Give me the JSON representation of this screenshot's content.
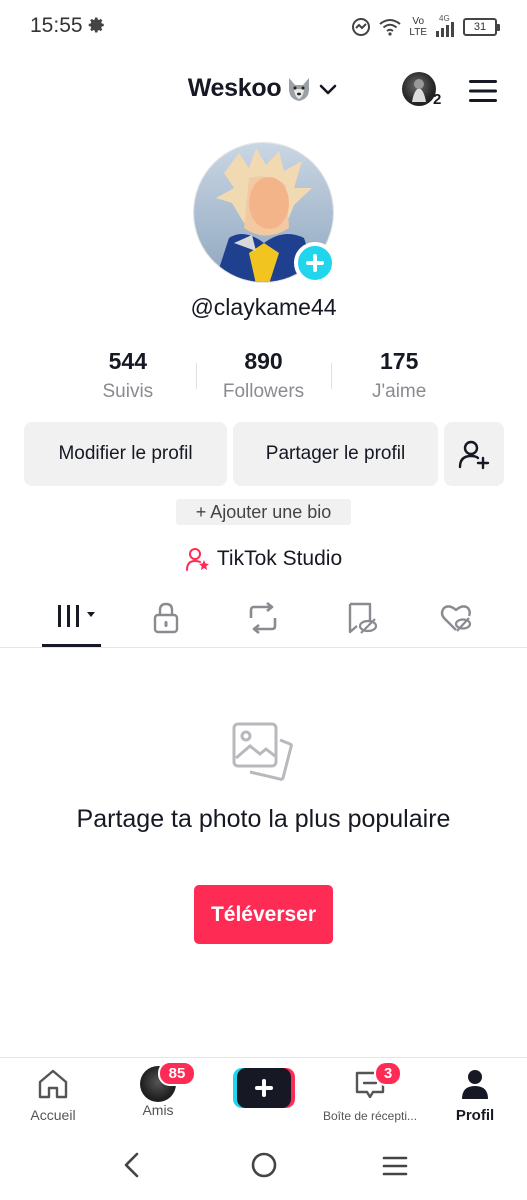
{
  "status": {
    "time": "15:55",
    "volte_top": "Vo",
    "volte_bottom": "LTE",
    "signal_label": "4G",
    "battery": "31"
  },
  "header": {
    "username": "Weskoo",
    "following_count_badge": "2"
  },
  "profile": {
    "handle": "@claykame44"
  },
  "stats": [
    {
      "value": "544",
      "label": "Suivis"
    },
    {
      "value": "890",
      "label": "Followers"
    },
    {
      "value": "175",
      "label": "J'aime"
    }
  ],
  "actions": {
    "edit": "Modifier le profil",
    "share": "Partager le profil",
    "add_bio": "+ Ajouter une bio",
    "studio": "TikTok Studio"
  },
  "empty_state": {
    "title": "Partage ta photo la plus populaire",
    "button": "Téléverser"
  },
  "bottom_nav": {
    "home": "Accueil",
    "friends": "Amis",
    "friends_badge": "85",
    "inbox": "Boîte de récepti...",
    "inbox_badge": "3",
    "profile": "Profil"
  },
  "colors": {
    "accent": "#fe2c55",
    "cyan": "#20d5ec",
    "text": "#161823",
    "muted": "#8a8b91"
  }
}
